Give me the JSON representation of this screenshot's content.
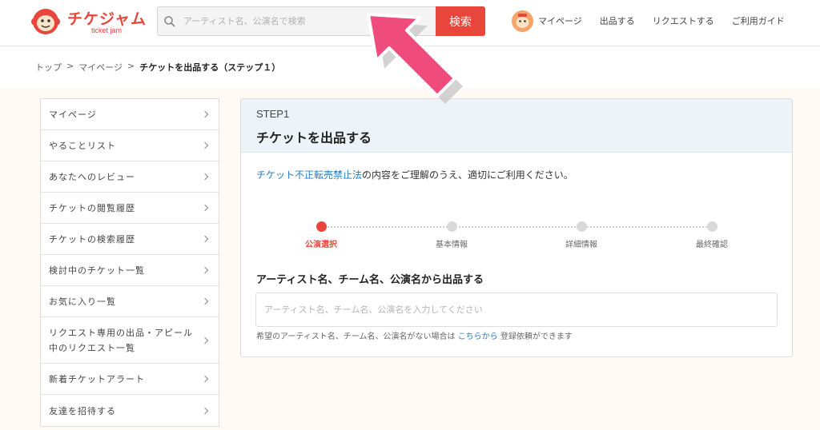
{
  "header": {
    "logo_text": "チケジャム",
    "logo_sub": "ticket jam",
    "search_placeholder": "アーティスト名、公演名で検索",
    "search_button": "検索",
    "nav": [
      "マイページ",
      "出品する",
      "リクエストする",
      "ご利用ガイド"
    ]
  },
  "breadcrumb": {
    "items": [
      "トップ",
      "マイページ"
    ],
    "separator": ">",
    "current": "チケットを出品する（ステップ１）"
  },
  "sidebar": {
    "items": [
      "マイページ",
      "やることリスト",
      "あなたへのレビュー",
      "チケットの閲覧履歴",
      "チケットの検索履歴",
      "検討中のチケット一覧",
      "お気に入り一覧",
      "リクエスト専用の出品・アピール中のリクエスト一覧",
      "新着チケットアラート",
      "友達を招待する"
    ]
  },
  "panel": {
    "step": "STEP1",
    "title": "チケットを出品する",
    "notice_link": "チケット不正転売禁止法",
    "notice_text": "の内容をご理解のうえ、適切にご利用ください。",
    "steps": [
      "公演選択",
      "基本情報",
      "詳細情報",
      "最終確認"
    ],
    "active_step": 0,
    "section_title": "アーティスト名、チーム名、公演名から出品する",
    "input_placeholder": "アーティスト名、チーム名、公演名を入力してください",
    "hint_before": "希望のアーティスト名、チーム名、公演名がない場合は",
    "hint_link": "こちらから",
    "hint_after": "登録依頼ができます"
  },
  "colors": {
    "accent": "#e8463c",
    "link": "#2a7bbf",
    "arrow": "#ef4b7d",
    "panel_head": "#eef3f9"
  },
  "icons": {
    "search": "search-icon",
    "arrow": "arrow-pointer-icon"
  }
}
